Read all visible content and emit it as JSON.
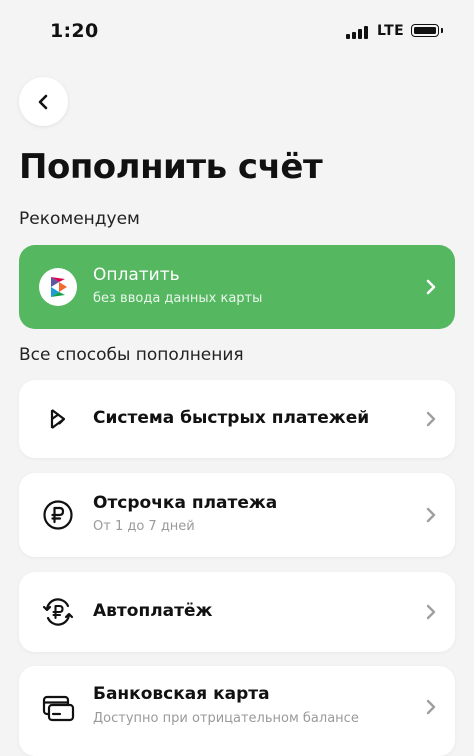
{
  "status_bar": {
    "time": "1:20",
    "network": "LTE"
  },
  "header": {
    "title": "Пополнить счёт"
  },
  "recommended": {
    "label": "Рекомендуем",
    "item": {
      "title": "Оплатить",
      "subtitle": "без ввода данных карты",
      "icon": "sbp-logo-icon"
    }
  },
  "all_methods": {
    "label": "Все способы пополнения",
    "items": [
      {
        "title": "Система быстрых платежей",
        "subtitle": "",
        "icon": "sbp-icon"
      },
      {
        "title": "Отсрочка платежа",
        "subtitle": "От 1 до 7 дней",
        "icon": "ruble-circle-icon"
      },
      {
        "title": "Автоплатёж",
        "subtitle": "",
        "icon": "auto-pay-icon"
      },
      {
        "title": "Банковская карта",
        "subtitle": "Доступно при отрицательном балансе",
        "icon": "bank-card-icon"
      }
    ]
  },
  "colors": {
    "accent_green": "#55b861",
    "background": "#f4f4f4",
    "chevron_gray": "#a0a0a0"
  }
}
